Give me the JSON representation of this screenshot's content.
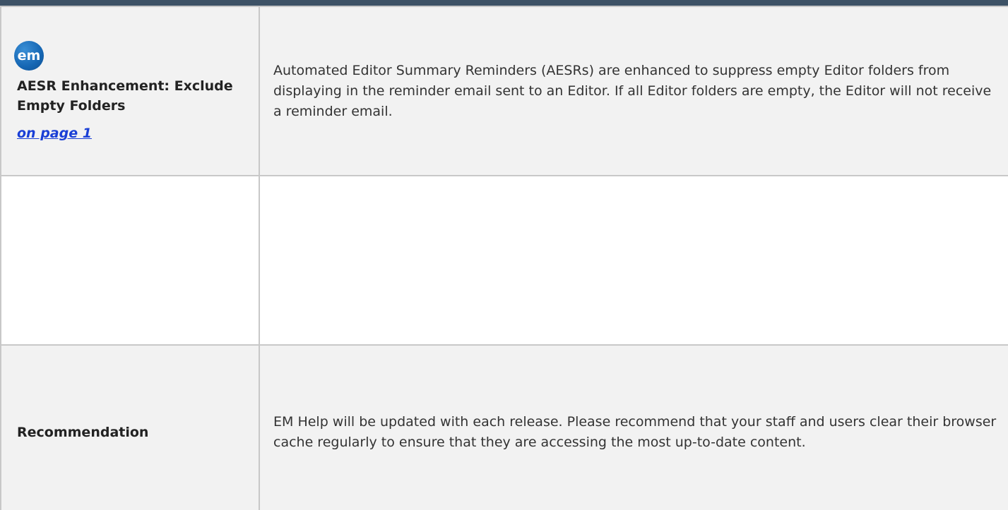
{
  "colors": {
    "header_bar": "#3d5266",
    "badge_blue": "#1566b3",
    "link_blue": "#1a3fd6",
    "row_shade": "#f2f2f2",
    "border": "#c8c8c8"
  },
  "rows": [
    {
      "badge": {
        "text": "em",
        "icon": "em-logo-icon"
      },
      "title": "AESR Enhancement: Exclude Empty Folders",
      "link_label": "on page 1",
      "description": "Automated Editor Summary Reminders (AESRs) are enhanced to suppress empty Editor folders from displaying in the reminder email sent to an Editor. If all Editor folders are empty, the Editor will not receive a reminder email."
    },
    {
      "title": "",
      "description": ""
    },
    {
      "title": "Recommendation",
      "description": "EM Help will be updated with each release. Please recommend that your staff and users clear their browser cache regularly to ensure that they are accessing the most up-to-date content."
    }
  ]
}
